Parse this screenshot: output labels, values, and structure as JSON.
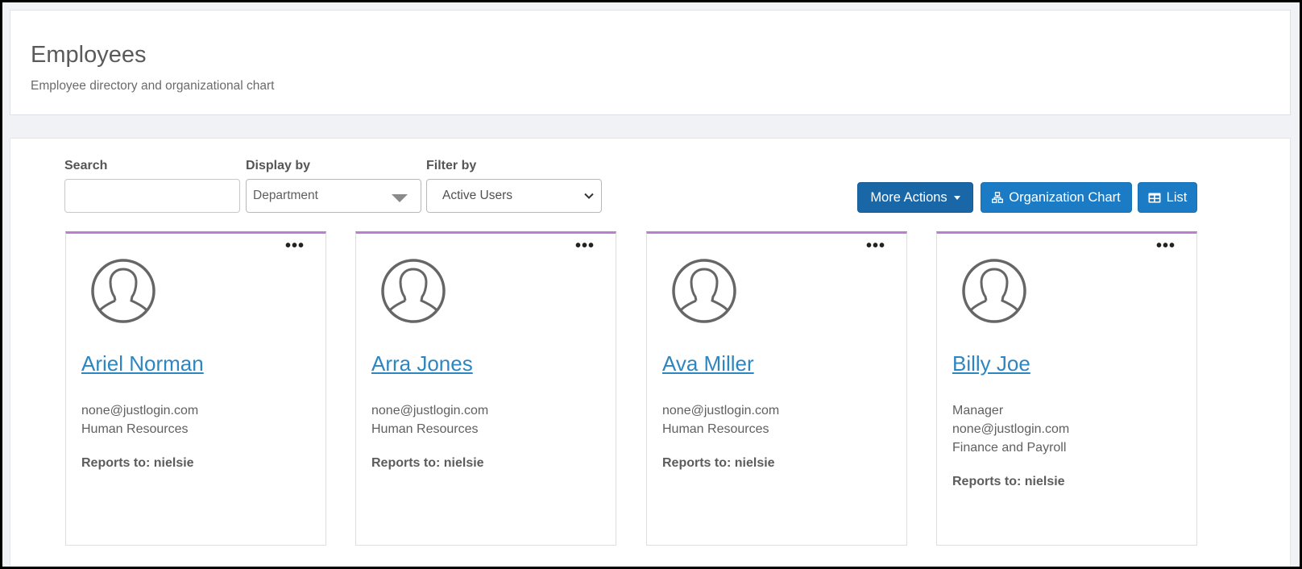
{
  "header": {
    "title": "Employees",
    "subtitle": "Employee directory and organizational chart"
  },
  "controls": {
    "search_label": "Search",
    "search_value": "",
    "search_placeholder": "",
    "display_label": "Display by",
    "display_value": "Department",
    "filter_label": "Filter by",
    "filter_value": "Active Users",
    "more_actions_label": "More Actions",
    "org_chart_label": "Organization Chart",
    "list_label": "List"
  },
  "colors": {
    "accent": "#1b7bc4",
    "more_actions_bg": "#1a67a8",
    "card_top_border": "#b97fd0",
    "link": "#2e86c1"
  },
  "icons": {
    "avatar": "user-outline-icon",
    "menu": "more-dots-icon",
    "org": "org-chart-icon",
    "list": "table-icon"
  },
  "employees": [
    {
      "name": "Ariel Norman",
      "lines": [
        "none@justlogin.com",
        "Human Resources"
      ],
      "reports_to": "Reports to: nielsie"
    },
    {
      "name": "Arra Jones",
      "lines": [
        "none@justlogin.com",
        "Human Resources"
      ],
      "reports_to": "Reports to: nielsie"
    },
    {
      "name": "Ava Miller",
      "lines": [
        "none@justlogin.com",
        "Human Resources"
      ],
      "reports_to": "Reports to: nielsie"
    },
    {
      "name": "Billy Joe",
      "lines": [
        "Manager",
        "none@justlogin.com",
        "Finance and Payroll"
      ],
      "reports_to": "Reports to: nielsie"
    }
  ]
}
